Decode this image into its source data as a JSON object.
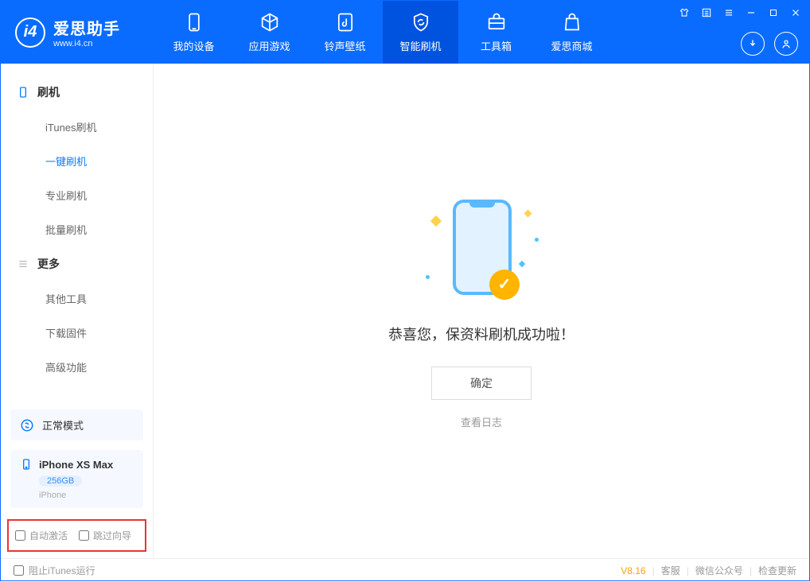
{
  "header": {
    "app_name_cn": "爱思助手",
    "app_name_en": "www.i4.cn",
    "tabs": [
      {
        "label": "我的设备"
      },
      {
        "label": "应用游戏"
      },
      {
        "label": "铃声壁纸"
      },
      {
        "label": "智能刷机"
      },
      {
        "label": "工具箱"
      },
      {
        "label": "爱思商城"
      }
    ]
  },
  "sidebar": {
    "section1": {
      "title": "刷机",
      "items": [
        {
          "label": "iTunes刷机"
        },
        {
          "label": "一键刷机"
        },
        {
          "label": "专业刷机"
        },
        {
          "label": "批量刷机"
        }
      ]
    },
    "section2": {
      "title": "更多",
      "items": [
        {
          "label": "其他工具"
        },
        {
          "label": "下载固件"
        },
        {
          "label": "高级功能"
        }
      ]
    },
    "mode_label": "正常模式",
    "device": {
      "name": "iPhone XS Max",
      "capacity": "256GB",
      "type": "iPhone"
    },
    "checkboxes": {
      "auto_activate": "自动激活",
      "skip_guide": "跳过向导"
    }
  },
  "main": {
    "success_text": "恭喜您，保资料刷机成功啦！",
    "ok_button": "确定",
    "view_log": "查看日志"
  },
  "footer": {
    "block_itunes": "阻止iTunes运行",
    "version": "V8.16",
    "links": [
      "客服",
      "微信公众号",
      "检查更新"
    ]
  }
}
